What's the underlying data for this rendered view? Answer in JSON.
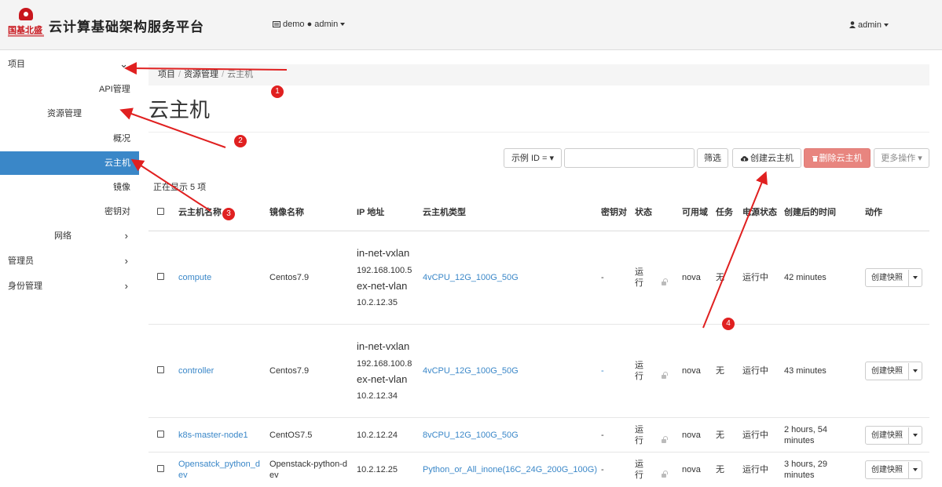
{
  "header": {
    "logo_text": "国基北盛",
    "brand": "云计算基础架构服务平台",
    "context_icon": "server-icon",
    "context": "demo ● admin",
    "user_icon": "user-icon",
    "user": "admin"
  },
  "sidebar": {
    "project": "项目",
    "api": "API管理",
    "resource": "资源管理",
    "overview": "概况",
    "instances": "云主机",
    "images": "镜像",
    "keypairs": "密钥对",
    "network": "网络",
    "admin": "管理员",
    "identity": "身份管理"
  },
  "breadcrumb": [
    "项目",
    "资源管理",
    "云主机"
  ],
  "page_title": "云主机",
  "toolbar": {
    "filter_select": "示例 ID = ▾",
    "filter_input": "",
    "filter_button": "筛选",
    "create_button": "创建云主机",
    "delete_button": "删除云主机",
    "more_button": "更多操作 ▾"
  },
  "count_text": "正在显示 5 项",
  "table": {
    "headers": [
      "云主机名称",
      "镜像名称",
      "IP 地址",
      "云主机类型",
      "密钥对",
      "状态",
      "可用域",
      "任务",
      "电源状态",
      "创建后的时间",
      "动作"
    ],
    "rows": [
      {
        "name": "compute",
        "image": "Centos7.9",
        "ip_net1": "in-net-vxlan",
        "ip_addr1": "192.168.100.5",
        "ip_net2": "ex-net-vlan",
        "ip_addr2": "10.2.12.35",
        "flavor": "4vCPU_12G_100G_50G",
        "key": "-",
        "status": "运行",
        "zone": "nova",
        "task": "无",
        "power": "运行中",
        "age": "42 minutes",
        "action": "创建快照"
      },
      {
        "name": "controller",
        "image": "Centos7.9",
        "ip_net1": "in-net-vxlan",
        "ip_addr1": "192.168.100.8",
        "ip_net2": "ex-net-vlan",
        "ip_addr2": "10.2.12.34",
        "flavor": "4vCPU_12G_100G_50G",
        "key": "-",
        "status": "运行",
        "zone": "nova",
        "task": "无",
        "power": "运行中",
        "age": "43 minutes",
        "action": "创建快照"
      },
      {
        "name": "k8s-master-node1",
        "image": "CentOS7.5",
        "ip": "10.2.12.24",
        "flavor": "8vCPU_12G_100G_50G",
        "key": "-",
        "status": "运行",
        "zone": "nova",
        "task": "无",
        "power": "运行中",
        "age": "2 hours, 54 minutes",
        "action": "创建快照"
      },
      {
        "name": "Opensatck_python_dev",
        "image": "Openstack-python-dev",
        "ip": "10.2.12.25",
        "flavor": "Python_or_All_inone(16C_24G_200G_100G)",
        "key": "-",
        "status": "运行",
        "zone": "nova",
        "task": "无",
        "power": "运行中",
        "age": "3 hours, 29 minutes",
        "action": "创建快照"
      }
    ]
  },
  "annotations": [
    "1",
    "2",
    "3",
    "4"
  ],
  "colors": {
    "accent": "#3a87c8",
    "danger": "#e8857f",
    "arrow": "#e02020"
  }
}
